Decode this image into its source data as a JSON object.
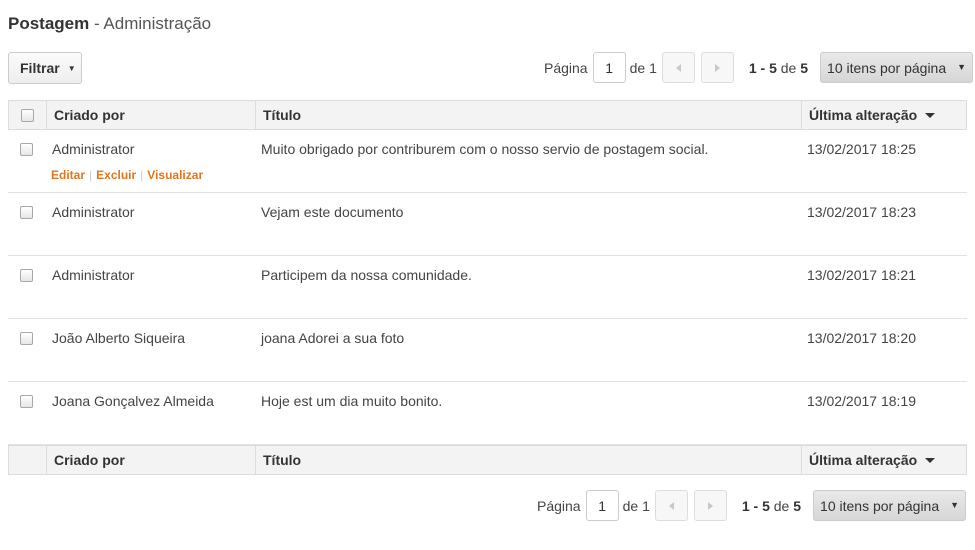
{
  "header": {
    "title_strong": "Postagem",
    "title_rest": " - Administração"
  },
  "toolbar": {
    "filter_label": "Filtrar"
  },
  "pagination": {
    "page_label": "Página",
    "current_page": "1",
    "of_label": "de",
    "total_pages": "1",
    "range": "1 - 5",
    "range_of": "de",
    "total_items": "5",
    "per_page": "10 itens por página"
  },
  "table": {
    "columns": {
      "created_by": "Criado por",
      "title": "Título",
      "last_modified": "Última alteração"
    },
    "row_actions": {
      "edit": "Editar",
      "delete": "Excluir",
      "view": "Visualizar"
    },
    "rows": [
      {
        "author": "Administrator",
        "title": "Muito obrigado por contriburem com o nosso servio de postagem social.",
        "modified": "13/02/2017 18:25"
      },
      {
        "author": "Administrator",
        "title": "Vejam este documento",
        "modified": "13/02/2017 18:23"
      },
      {
        "author": "Administrator",
        "title": "Participem da nossa comunidade.",
        "modified": "13/02/2017 18:21"
      },
      {
        "author": "João Alberto Siqueira",
        "title": "joana Adorei a sua foto",
        "modified": "13/02/2017 18:20"
      },
      {
        "author": "Joana Gonçalvez Almeida",
        "title": "Hoje est um dia muito bonito.",
        "modified": "13/02/2017 18:19"
      }
    ]
  },
  "colors": {
    "action_link": "#e0761f",
    "header_bg": "#f3f3f3",
    "border": "#dcdcdc"
  }
}
